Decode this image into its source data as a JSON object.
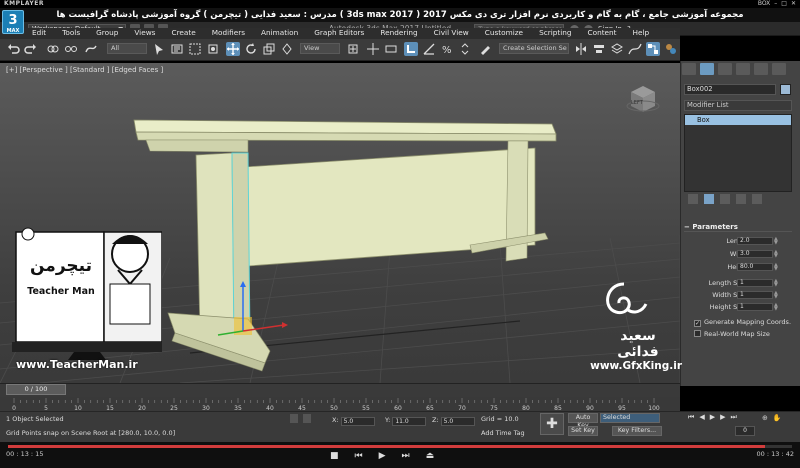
{
  "player": {
    "brand": "KMPLAYER",
    "window_label": "BOX",
    "video_title": "مجموعه آموزشی جامع ، گام به گام و کاربردی نرم افزار تری دی مکس 2017 ( 3ds max 2017 )  مدرس : سعید فدایی ( تیچرمن ) گروه آموزشی پادشاه گرافیست ها",
    "time_elapsed": "00 : 13 : 15",
    "time_total": "00 : 13 : 42",
    "progress": 0.965
  },
  "app": {
    "logo_text": "3",
    "logo_sub": "MAX",
    "workspace": "Workspace: Default",
    "title": "Autodesk 3ds Max 2017     Untitled",
    "search_placeholder": "Type a keyword or phrase",
    "sign_in": "Sign In",
    "help": "?"
  },
  "menu": [
    "Edit",
    "Tools",
    "Group",
    "Views",
    "Create",
    "Modifiers",
    "Animation",
    "Graph Editors",
    "Rendering",
    "Civil View",
    "Customize",
    "Scripting",
    "Content",
    "Help"
  ],
  "toolbar": {
    "filter": "All",
    "view": "View",
    "selection_set": "Create Selection Se"
  },
  "viewport": {
    "label": "[+] [Perspective ] [Standard ] [Edged Faces ]",
    "cube_label": "LEFT"
  },
  "panel": {
    "object_name": "Box002",
    "modifier_list": "Modifier List",
    "stack_item": "Box",
    "params_title": "Parameters",
    "params": [
      {
        "label": "Length:",
        "value": "2.0"
      },
      {
        "label": "Width:",
        "value": "3.0"
      },
      {
        "label": "Height:",
        "value": "80.0"
      },
      {
        "label": "Length Segs:",
        "value": "1"
      },
      {
        "label": "Width Segs:",
        "value": "1"
      },
      {
        "label": "Height Segs:",
        "value": "1"
      }
    ],
    "checks": [
      {
        "label": "Generate Mapping Coords.",
        "checked": true
      },
      {
        "label": "Real-World Map Size",
        "checked": false
      }
    ]
  },
  "timeline": {
    "frame": "0 / 100",
    "ticks": [
      "0",
      "5",
      "10",
      "15",
      "20",
      "25",
      "30",
      "35",
      "40",
      "45",
      "50",
      "55",
      "60",
      "65",
      "70",
      "75",
      "80",
      "85",
      "90",
      "95",
      "100"
    ]
  },
  "status": {
    "selection": "1 Object Selected",
    "prompt": "Grid Points snap on Scene Root at [280.0, 10.0, 0.0]",
    "x_label": "X:",
    "x": "5.0",
    "y_label": "Y:",
    "y": "11.0",
    "z_label": "Z:",
    "z": "5.0",
    "grid": "Grid = 10.0",
    "add_time_tag": "Add Time Tag",
    "auto_key": "Auto Key",
    "set_key": "Set Key",
    "selected": "Selected",
    "key_filters": "Key Filters...",
    "current_frame": "0"
  },
  "watermarks": {
    "teacher_brand": "تیچرمن",
    "teacher_name": "Teacher Man",
    "teacher_url": "www.TeacherMan.ir",
    "gfx_name": "سعید فدائی",
    "gfx_url": "www.GfxKing.ir"
  },
  "colors": {
    "table": "#e6ebc4",
    "table_edge": "#8c8f6c",
    "selection": "#5ed4d6",
    "accent": "#6c9bc1"
  }
}
